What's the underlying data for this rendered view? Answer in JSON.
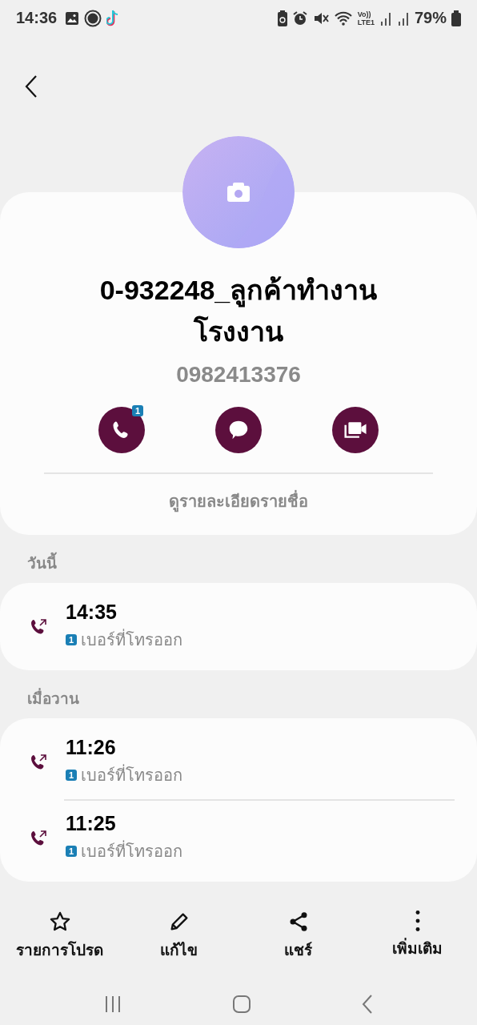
{
  "status_bar": {
    "time": "14:36",
    "network_top": "Vo))",
    "network_bottom": "LTE1",
    "battery": "79%"
  },
  "contact": {
    "name": "0-932248_ลูกค้าทำงาน โรงงาน",
    "number": "0982413376",
    "call_badge": "1",
    "details_link": "ดูรายละเอียดรายชื่อ"
  },
  "call_groups": [
    {
      "heading": "วันนี้",
      "calls": [
        {
          "kind": "outgoing",
          "time": "14:35",
          "sim": "1",
          "label": "เบอร์ที่โทรออก"
        }
      ]
    },
    {
      "heading": "เมื่อวาน",
      "calls": [
        {
          "kind": "outgoing",
          "time": "11:26",
          "sim": "1",
          "label": "เบอร์ที่โทรออก"
        },
        {
          "kind": "outgoing",
          "time": "11:25",
          "sim": "1",
          "label": "เบอร์ที่โทรออก"
        }
      ]
    }
  ],
  "bottom_actions": [
    {
      "kind": "star",
      "label": "รายการโปรด"
    },
    {
      "kind": "edit",
      "label": "แก้ไข"
    },
    {
      "kind": "share",
      "label": "แชร์"
    },
    {
      "kind": "more",
      "label": "เพิ่มเติม"
    }
  ]
}
